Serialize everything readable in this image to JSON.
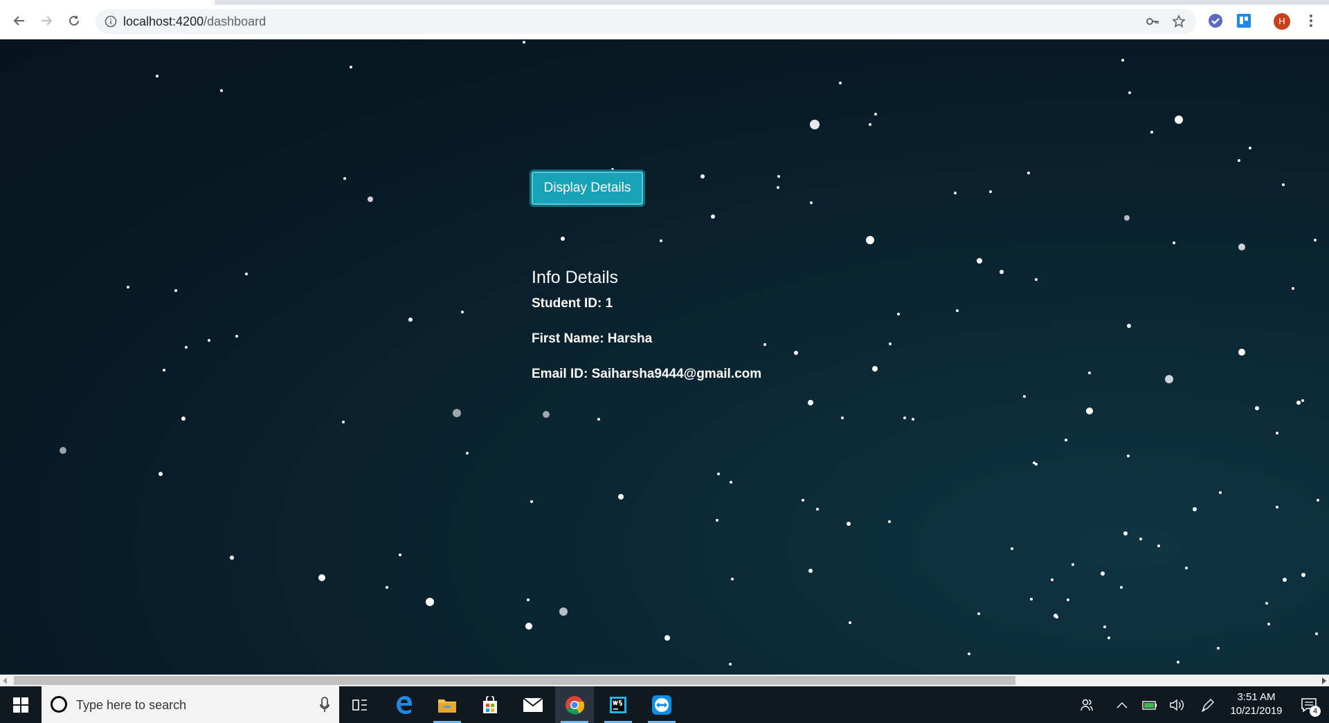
{
  "browser": {
    "url_host": "localhost:4200",
    "url_path": "/dashboard",
    "profile_initial": "H"
  },
  "page": {
    "button_label": "Display Details",
    "heading": "Info Details",
    "student_id": "Student ID: 1",
    "first_name": "First Name: Harsha",
    "email": "Email ID: Saiharsha9444@gmail.com"
  },
  "taskbar": {
    "search_placeholder": "Type here to search",
    "time": "3:51 AM",
    "date": "10/21/2019",
    "notification_count": "4"
  },
  "colors": {
    "button_bg": "#17a2b8",
    "page_bg": "#0b1d27",
    "taskbar_bg": "#101820"
  }
}
